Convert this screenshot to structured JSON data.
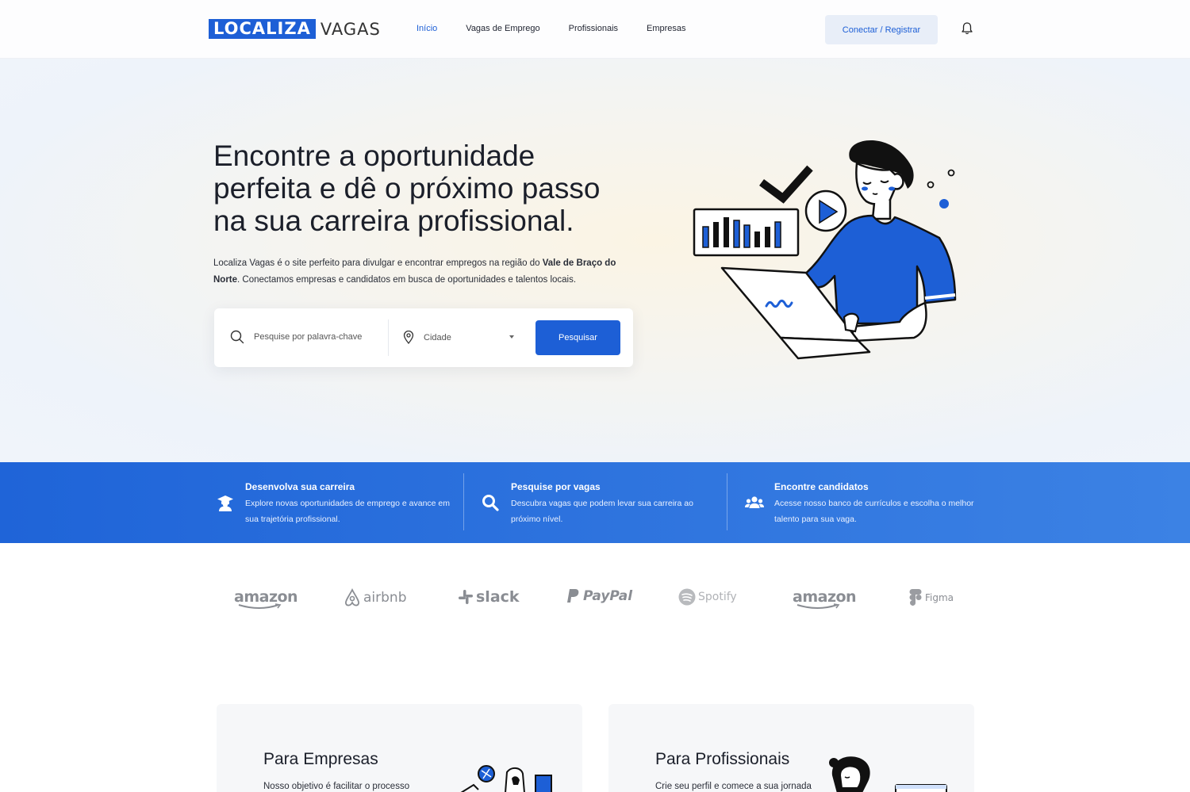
{
  "nav": {
    "logo_box": "LOCALIZA",
    "logo_rest": "VAGAS",
    "links": [
      "Início",
      "Vagas de Emprego",
      "Profissionais",
      "Empresas"
    ],
    "connect_label": "Conectar / Registrar"
  },
  "hero": {
    "title": "Encontre a oportunidade perfeita e dê o próximo passo na sua carreira profissional.",
    "desc_part1": "Localiza Vagas é o site perfeito para divulgar e encontrar empregos na região do ",
    "desc_bold": "Vale de Braço do Norte",
    "desc_part2": ". Conectamos empresas e candidatos em busca de oportunidades e talentos locais."
  },
  "search": {
    "keyword_placeholder": "Pesquise por palavra-chave",
    "city_placeholder": "Cidade",
    "button_label": "Pesquisar"
  },
  "features": [
    {
      "title": "Desenvolva sua carreira",
      "text": "Explore novas oportunidades de emprego e avance em sua trajetória profissional.",
      "icon": "graduate-icon"
    },
    {
      "title": "Pesquise por vagas",
      "text": "Descubra vagas que podem levar sua carreira ao próximo nível.",
      "icon": "search-icon"
    },
    {
      "title": "Encontre candidatos",
      "text": "Acesse nosso banco de currículos e escolha o melhor talento para sua vaga.",
      "icon": "users-icon"
    }
  ],
  "brands": [
    "amazon",
    "airbnb",
    "slack",
    "PayPal",
    "Spotify",
    "amazon",
    "Figma"
  ],
  "cards": [
    {
      "title": "Para Empresas",
      "text": "Nosso objetivo é facilitar o processo"
    },
    {
      "title": "Para Profissionais",
      "text": "Crie seu perfil e comece a sua jornada"
    }
  ],
  "colors": {
    "accent": "#1d5fd6",
    "band_start": "#1f64d8",
    "band_end": "#3c82e4"
  }
}
